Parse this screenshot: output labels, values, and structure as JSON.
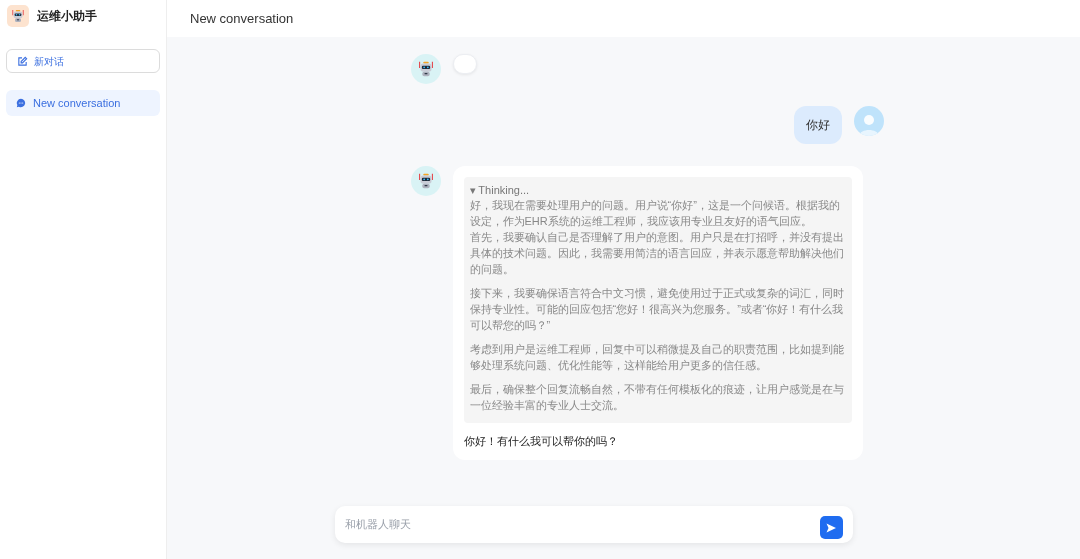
{
  "app": {
    "title": "运维小助手"
  },
  "sidebar": {
    "new_chat_button": "新对话",
    "conversations": [
      {
        "label": "New conversation",
        "selected": true
      }
    ]
  },
  "header": {
    "title": "New conversation"
  },
  "messages": [
    {
      "kind": "bot_loading"
    },
    {
      "kind": "user_text",
      "text": "你好"
    },
    {
      "kind": "bot_text",
      "thinking": {
        "label": "▾ Thinking...",
        "expanded": true,
        "paragraphs": [
          [
            "好，我现在需要处理用户的问题。用户说“你好”，这是一个问候语。根据我的设定，作为EHR系统的运维工程师，我应该用专业且友好的语气回应。",
            "首先，我要确认自己是否理解了用户的意图。用户只是在打招呼，并没有提出具体的技术问题。因此，我需要用简洁的语言回应，并表示愿意帮助解决他们的问题。"
          ],
          [
            "接下来，我要确保语言符合中文习惯，避免使用过于正式或复杂的词汇，同时保持专业性。可能的回应包括“您好！很高兴为您服务。”或者“你好！有什么我可以帮您的吗？”"
          ],
          [
            "考虑到用户是运维工程师，回复中可以稍微提及自己的职责范围，比如提到能够处理系统问题、优化性能等，这样能给用户更多的信任感。"
          ],
          [
            "最后，确保整个回复流畅自然，不带有任何模板化的痕迹，让用户感觉是在与一位经验丰富的专业人士交流。"
          ]
        ]
      },
      "text": "你好！有什么我可以帮你的吗？"
    }
  ],
  "composer": {
    "placeholder": "和机器人聊天"
  }
}
